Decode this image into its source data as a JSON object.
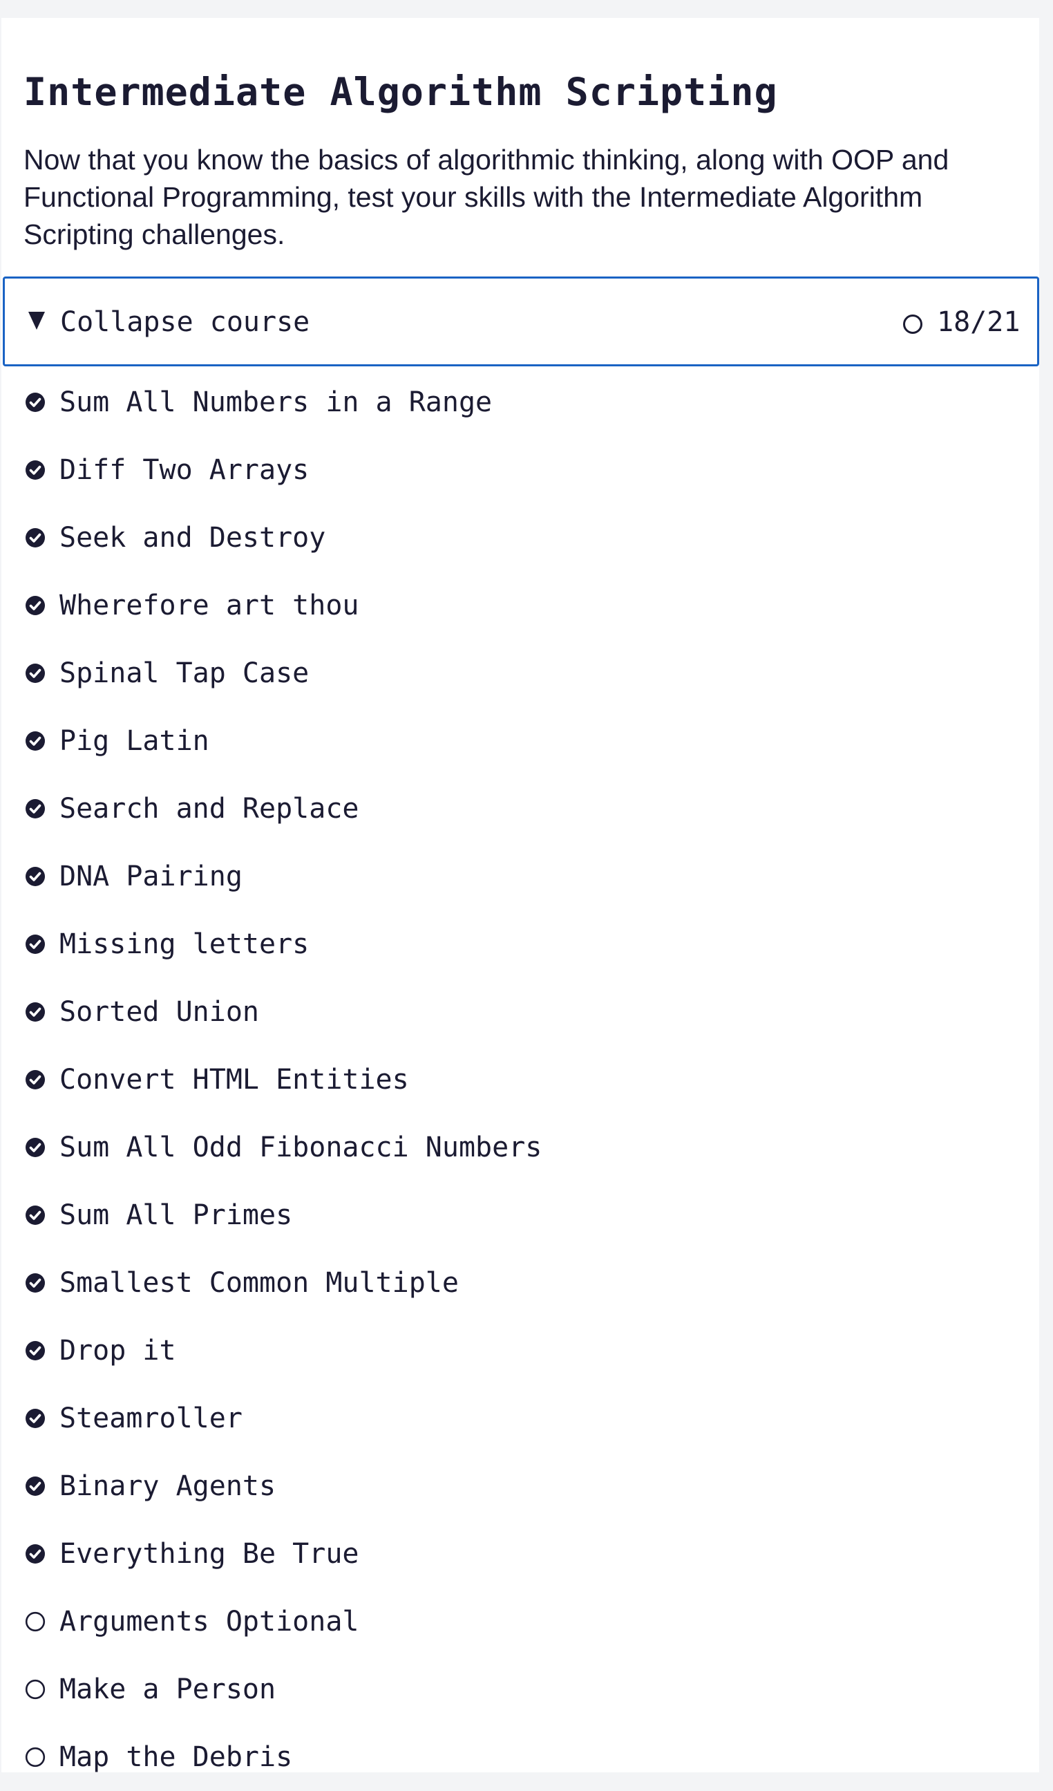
{
  "section": {
    "title": "Intermediate Algorithm Scripting",
    "description": "Now that you know the basics of algorithmic thinking, along with OOP and Functional Programming, test your skills with the Intermediate Algorithm Scripting challenges."
  },
  "course": {
    "toggle_label": "Collapse course",
    "progress_text": "18/21",
    "completed_count": 18,
    "total_count": 21,
    "progress_icon": "circle-outline-icon",
    "toggle_icon": "triangle-down-icon"
  },
  "lessons": [
    {
      "title": "Sum All Numbers in a Range",
      "completed": true
    },
    {
      "title": "Diff Two Arrays",
      "completed": true
    },
    {
      "title": "Seek and Destroy",
      "completed": true
    },
    {
      "title": "Wherefore art thou",
      "completed": true
    },
    {
      "title": "Spinal Tap Case",
      "completed": true
    },
    {
      "title": "Pig Latin",
      "completed": true
    },
    {
      "title": "Search and Replace",
      "completed": true
    },
    {
      "title": "DNA Pairing",
      "completed": true
    },
    {
      "title": "Missing letters",
      "completed": true
    },
    {
      "title": "Sorted Union",
      "completed": true
    },
    {
      "title": "Convert HTML Entities",
      "completed": true
    },
    {
      "title": "Sum All Odd Fibonacci Numbers",
      "completed": true
    },
    {
      "title": "Sum All Primes",
      "completed": true
    },
    {
      "title": "Smallest Common Multiple",
      "completed": true
    },
    {
      "title": "Drop it",
      "completed": true
    },
    {
      "title": "Steamroller",
      "completed": true
    },
    {
      "title": "Binary Agents",
      "completed": true
    },
    {
      "title": "Everything Be True",
      "completed": true
    },
    {
      "title": "Arguments Optional",
      "completed": false
    },
    {
      "title": "Make a Person",
      "completed": false
    },
    {
      "title": "Map the Debris",
      "completed": false
    }
  ],
  "colors": {
    "text": "#1b1b32",
    "accent_border": "#1a63c4",
    "page_background": "#f3f4f6",
    "card_background": "#ffffff"
  }
}
